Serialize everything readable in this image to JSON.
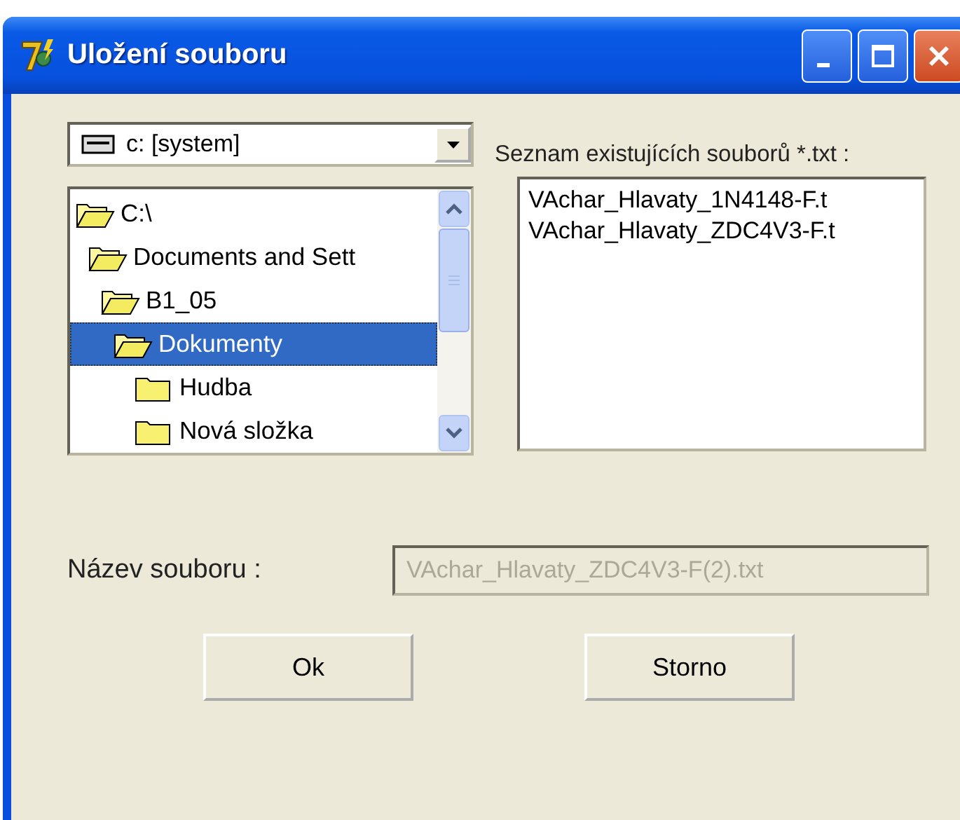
{
  "window": {
    "title": "Uložení souboru"
  },
  "drive": {
    "value": "c: [system]"
  },
  "tree": [
    {
      "label": "C:\\",
      "expanded": true,
      "selected": false,
      "children": [
        {
          "label": "Documents and Sett",
          "expanded": true,
          "selected": false,
          "children": [
            {
              "label": "B1_05",
              "expanded": true,
              "selected": false,
              "children": [
                {
                  "label": "Dokumenty",
                  "expanded": true,
                  "selected": true,
                  "children": [
                    {
                      "label": "Hudba",
                      "expanded": false,
                      "selected": false
                    },
                    {
                      "label": "Nová složka",
                      "expanded": false,
                      "selected": false
                    }
                  ]
                }
              ]
            }
          ]
        }
      ]
    }
  ],
  "files_label": "Seznam existujících souborů *.txt :",
  "files": [
    "VAchar_Hlavaty_1N4148-F.t",
    "VAchar_Hlavaty_ZDC4V3-F.t"
  ],
  "filename": {
    "label": "Název souboru :",
    "value": "VAchar_Hlavaty_ZDC4V3-F(2).txt",
    "disabled": true
  },
  "buttons": [
    "Ok",
    "Storno"
  ]
}
